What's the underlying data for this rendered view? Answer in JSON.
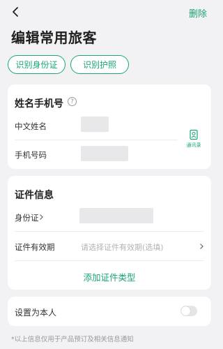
{
  "header": {
    "back_icon": "chevron-left-icon",
    "delete_label": "删除",
    "title": "编辑常用旅客"
  },
  "id_scan": {
    "id_card_label": "识别身份证",
    "passport_label": "识别护照"
  },
  "name_phone": {
    "title": "姓名手机号",
    "help_icon": "question-circle-icon",
    "help_glyph": "?",
    "chinese_name_label": "中文姓名",
    "phone_label": "手机号码",
    "contacts_icon": "address-book-icon",
    "contacts_label": "通讯录"
  },
  "documents": {
    "title": "证件信息",
    "id_type_label": "身份证",
    "validity_label": "证件有效期",
    "validity_placeholder": "请选择证件有效期(选填)",
    "add_type_label": "添加证件类型"
  },
  "self": {
    "label": "设置为本人",
    "toggle_on": false
  },
  "footnote": "*以上信息仅用于产品预订及相关信息通知",
  "colors": {
    "accent": "#1aa672",
    "background": "#f2f2f4"
  }
}
